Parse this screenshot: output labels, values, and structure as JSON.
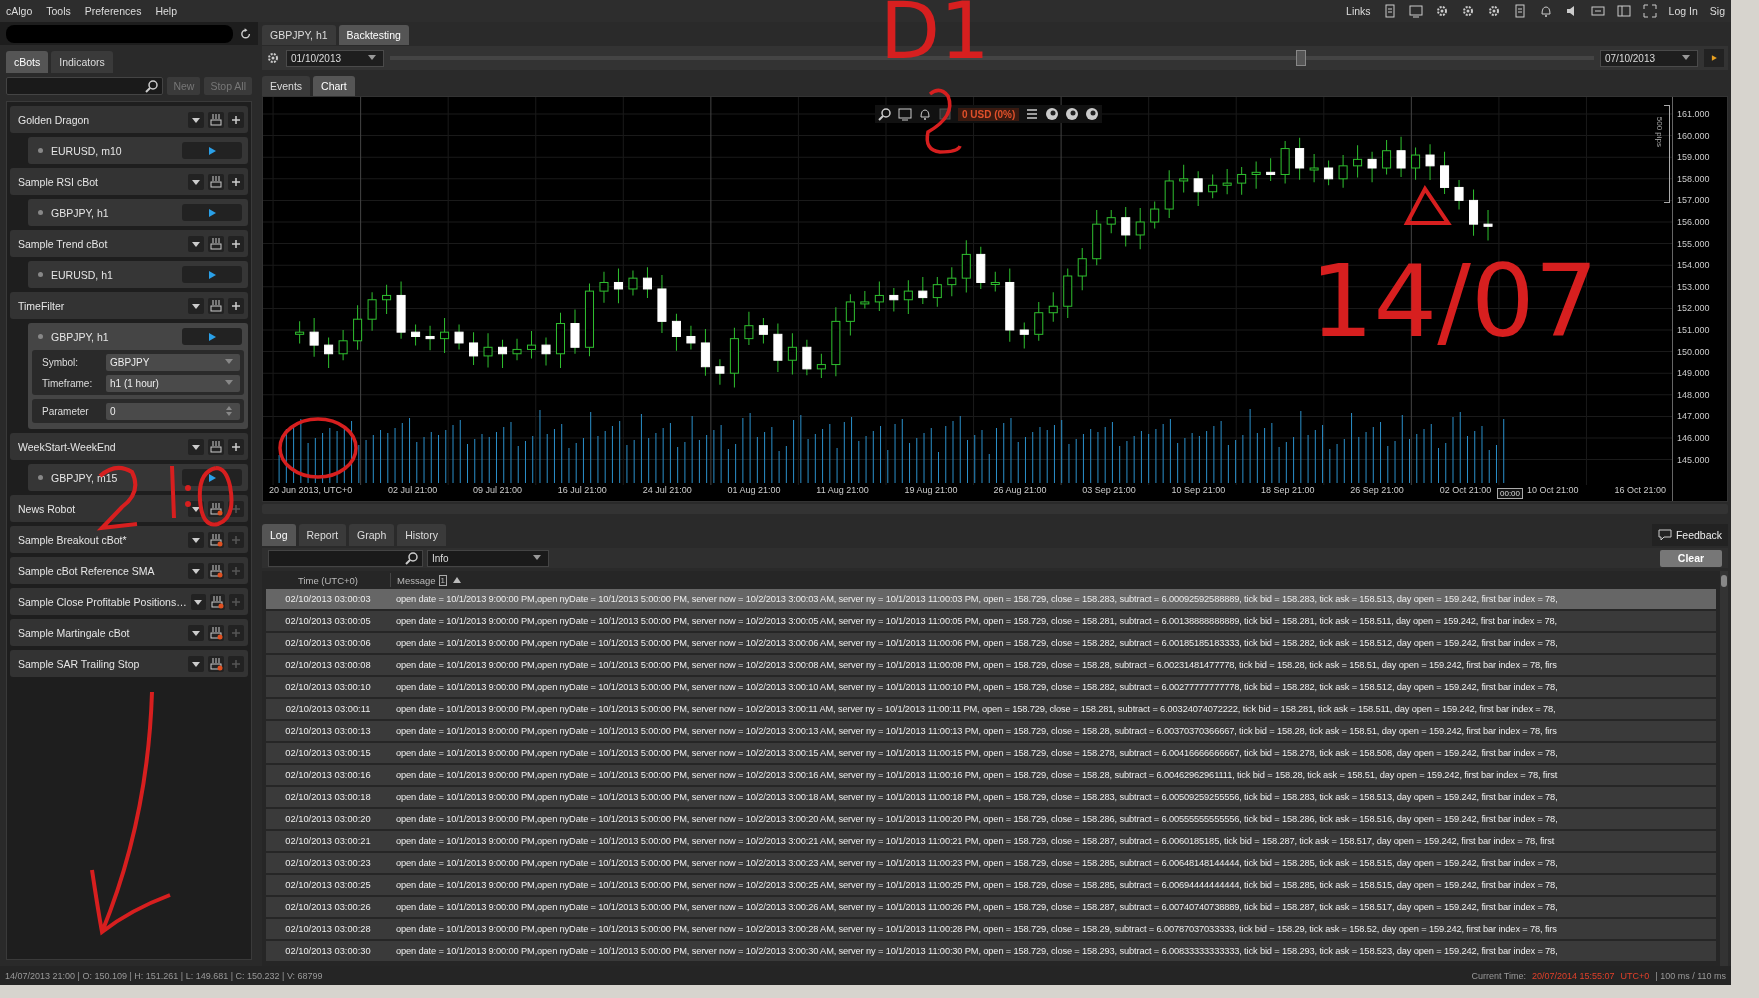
{
  "menu": [
    "cAlgo",
    "Tools",
    "Preferences",
    "Help"
  ],
  "header_right": {
    "links": "Links",
    "login": "Log In",
    "signup": "Sig"
  },
  "sidebar": {
    "tabs": [
      {
        "label": "cBots",
        "selected": true
      },
      {
        "label": "Indicators",
        "selected": false
      }
    ],
    "buttons": [
      {
        "label": "New",
        "disabled": true
      },
      {
        "label": "Stop All",
        "disabled": true
      }
    ],
    "bots": [
      {
        "name": "Golden Dragon",
        "built": true,
        "instances": [
          {
            "symbol": "EURUSD, m10",
            "expanded": false
          }
        ]
      },
      {
        "name": "Sample RSI cBot",
        "built": true,
        "instances": [
          {
            "symbol": "GBPJPY, h1",
            "expanded": false
          }
        ]
      },
      {
        "name": "Sample Trend cBot",
        "built": true,
        "instances": [
          {
            "symbol": "EURUSD, h1",
            "expanded": false
          }
        ]
      },
      {
        "name": "TimeFilter",
        "built": true,
        "instances": [
          {
            "symbol": "GBPJPY, h1",
            "expanded": true,
            "parameters": [
              {
                "label": "Symbol:",
                "value": "GBPJPY",
                "kind": "select"
              },
              {
                "label": "Timeframe:",
                "value": "h1 (1 hour)",
                "kind": "select"
              },
              {
                "label": "Parameter",
                "value": "0",
                "kind": "number"
              }
            ]
          }
        ]
      },
      {
        "name": "WeekStart-WeekEnd",
        "built": true,
        "instances": [
          {
            "symbol": "GBPJPY, m15",
            "expanded": false
          }
        ]
      },
      {
        "name": "News Robot",
        "built": false
      },
      {
        "name": "Sample Breakout cBot*",
        "built": false
      },
      {
        "name": "Sample cBot Reference SMA",
        "built": false
      },
      {
        "name": "Sample Close Profitable Positions…",
        "built": false
      },
      {
        "name": "Sample Martingale cBot",
        "built": false
      },
      {
        "name": "Sample SAR Trailing Stop",
        "built": false
      }
    ]
  },
  "tabs": [
    {
      "label": "GBPJPY, h1",
      "selected": false
    },
    {
      "label": "Backtesting",
      "selected": true
    }
  ],
  "backtest": {
    "start": "01/10/2013",
    "end": "07/10/2013",
    "level": 0.757
  },
  "view_tabs": [
    {
      "label": "Events",
      "selected": false
    },
    {
      "label": "Chart",
      "selected": true
    }
  ],
  "chart": {
    "balance": "0 USD (0%)",
    "pips_label": "500 pips",
    "cursor_label": "00:00",
    "y_labels": [
      "161.000",
      "160.000",
      "159.000",
      "158.000",
      "157.000",
      "156.000",
      "155.000",
      "154.000",
      "153.000",
      "152.000",
      "151.000",
      "150.000",
      "149.000",
      "148.000",
      "147.000",
      "146.000",
      "145.000"
    ],
    "x_labels": [
      "20 Jun 2013, UTC+0",
      "02 Jul 21:00",
      "09 Jul 21:00",
      "16 Jul 21:00",
      "24 Jul 21:00",
      "01 Aug 21:00",
      "11 Aug 21:00",
      "19 Aug 21:00",
      "26 Aug 21:00",
      "03 Sep 21:00",
      "10 Sep 21:00",
      "18 Sep 21:00",
      "26 Sep 21:00",
      "02 Oct 21:00",
      "10 Oct 21:00",
      "16 Oct 21:00"
    ]
  },
  "log": {
    "tabs": [
      {
        "label": "Log",
        "selected": true
      },
      {
        "label": "Report",
        "selected": false
      },
      {
        "label": "Graph",
        "selected": false
      },
      {
        "label": "History",
        "selected": false
      }
    ],
    "feedback": "Feedback",
    "level": "Info",
    "clear": "Clear",
    "columns": {
      "time": "Time (UTC+0)",
      "message": "Message",
      "filter_count": "1"
    },
    "rows": [
      {
        "time": "02/10/2013 03:00:03",
        "selected": true,
        "message": "open date = 10/1/2013 9:00:00 PM,open nyDate = 10/1/2013 5:00:00 PM, server now = 10/2/2013 3:00:03 AM, server ny = 10/1/2013 11:00:03 PM, open = 158.729, close = 158.283, subtract = 6.00092592588889, tick bid = 158.283, tick ask = 158.513, day open = 159.242, first bar index = 78,"
      },
      {
        "time": "02/10/2013 03:00:05",
        "selected": false,
        "message": "open date = 10/1/2013 9:00:00 PM,open nyDate = 10/1/2013 5:00:00 PM, server now = 10/2/2013 3:00:05 AM, server ny = 10/1/2013 11:00:05 PM, open = 158.729, close = 158.281, subtract = 6.00138888888889, tick bid = 158.281, tick ask = 158.511, day open = 159.242, first bar index = 78,"
      },
      {
        "time": "02/10/2013 03:00:06",
        "selected": false,
        "message": "open date = 10/1/2013 9:00:00 PM,open nyDate = 10/1/2013 5:00:00 PM, server now = 10/2/2013 3:00:06 AM, server ny = 10/1/2013 11:00:06 PM, open = 158.729, close = 158.282, subtract = 6.00185185183333, tick bid = 158.282, tick ask = 158.512, day open = 159.242, first bar index = 78,"
      },
      {
        "time": "02/10/2013 03:00:08",
        "selected": false,
        "message": "open date = 10/1/2013 9:00:00 PM,open nyDate = 10/1/2013 5:00:00 PM, server now = 10/2/2013 3:00:08 AM, server ny = 10/1/2013 11:00:08 PM, open = 158.729, close = 158.28, subtract = 6.00231481477778, tick bid = 158.28, tick ask = 158.51, day open = 159.242, first bar index = 78, firs"
      },
      {
        "time": "02/10/2013 03:00:10",
        "selected": false,
        "message": "open date = 10/1/2013 9:00:00 PM,open nyDate = 10/1/2013 5:00:00 PM, server now = 10/2/2013 3:00:10 AM, server ny = 10/1/2013 11:00:10 PM, open = 158.729, close = 158.282, subtract = 6.00277777777778, tick bid = 158.282, tick ask = 158.512, day open = 159.242, first bar index = 78,"
      },
      {
        "time": "02/10/2013 03:00:11",
        "selected": false,
        "message": "open date = 10/1/2013 9:00:00 PM,open nyDate = 10/1/2013 5:00:00 PM, server now = 10/2/2013 3:00:11 AM, server ny = 10/1/2013 11:00:11 PM, open = 158.729, close = 158.281, subtract = 6.00324074072222, tick bid = 158.281, tick ask = 158.511, day open = 159.242, first bar index = 78,"
      },
      {
        "time": "02/10/2013 03:00:13",
        "selected": false,
        "message": "open date = 10/1/2013 9:00:00 PM,open nyDate = 10/1/2013 5:00:00 PM, server now = 10/2/2013 3:00:13 AM, server ny = 10/1/2013 11:00:13 PM, open = 158.729, close = 158.28, subtract = 6.00370370366667, tick bid = 158.28, tick ask = 158.51, day open = 159.242, first bar index = 78, firs"
      },
      {
        "time": "02/10/2013 03:00:15",
        "selected": false,
        "message": "open date = 10/1/2013 9:00:00 PM,open nyDate = 10/1/2013 5:00:00 PM, server now = 10/2/2013 3:00:15 AM, server ny = 10/1/2013 11:00:15 PM, open = 158.729, close = 158.278, subtract = 6.00416666666667, tick bid = 158.278, tick ask = 158.508, day open = 159.242, first bar index = 78,"
      },
      {
        "time": "02/10/2013 03:00:16",
        "selected": false,
        "message": "open date = 10/1/2013 9:00:00 PM,open nyDate = 10/1/2013 5:00:00 PM, server now = 10/2/2013 3:00:16 AM, server ny = 10/1/2013 11:00:16 PM, open = 158.729, close = 158.28, subtract = 6.00462962961111, tick bid = 158.28, tick ask = 158.51, day open = 159.242, first bar index = 78, first"
      },
      {
        "time": "02/10/2013 03:00:18",
        "selected": false,
        "message": "open date = 10/1/2013 9:00:00 PM,open nyDate = 10/1/2013 5:00:00 PM, server now = 10/2/2013 3:00:18 AM, server ny = 10/1/2013 11:00:18 PM, open = 158.729, close = 158.283, subtract = 6.00509259255556, tick bid = 158.283, tick ask = 158.513, day open = 159.242, first bar index = 78,"
      },
      {
        "time": "02/10/2013 03:00:20",
        "selected": false,
        "message": "open date = 10/1/2013 9:00:00 PM,open nyDate = 10/1/2013 5:00:00 PM, server now = 10/2/2013 3:00:20 AM, server ny = 10/1/2013 11:00:20 PM, open = 158.729, close = 158.286, subtract = 6.00555555555556, tick bid = 158.286, tick ask = 158.516, day open = 159.242, first bar index = 78,"
      },
      {
        "time": "02/10/2013 03:00:21",
        "selected": false,
        "message": "open date = 10/1/2013 9:00:00 PM,open nyDate = 10/1/2013 5:00:00 PM, server now = 10/2/2013 3:00:21 AM, server ny = 10/1/2013 11:00:21 PM, open = 158.729, close = 158.287, subtract = 6.0060185185, tick bid = 158.287, tick ask = 158.517, day open = 159.242, first bar index = 78, first"
      },
      {
        "time": "02/10/2013 03:00:23",
        "selected": false,
        "message": "open date = 10/1/2013 9:00:00 PM,open nyDate = 10/1/2013 5:00:00 PM, server now = 10/2/2013 3:00:23 AM, server ny = 10/1/2013 11:00:23 PM, open = 158.729, close = 158.285, subtract = 6.00648148144444, tick bid = 158.285, tick ask = 158.515, day open = 159.242, first bar index = 78,"
      },
      {
        "time": "02/10/2013 03:00:25",
        "selected": false,
        "message": "open date = 10/1/2013 9:00:00 PM,open nyDate = 10/1/2013 5:00:00 PM, server now = 10/2/2013 3:00:25 AM, server ny = 10/1/2013 11:00:25 PM, open = 158.729, close = 158.285, subtract = 6.00694444444444, tick bid = 158.285, tick ask = 158.515, day open = 159.242, first bar index = 78,"
      },
      {
        "time": "02/10/2013 03:00:26",
        "selected": false,
        "message": "open date = 10/1/2013 9:00:00 PM,open nyDate = 10/1/2013 5:00:00 PM, server now = 10/2/2013 3:00:26 AM, server ny = 10/1/2013 11:00:26 PM, open = 158.729, close = 158.287, subtract = 6.00740740738889, tick bid = 158.287, tick ask = 158.517, day open = 159.242, first bar index = 78,"
      },
      {
        "time": "02/10/2013 03:00:28",
        "selected": false,
        "message": "open date = 10/1/2013 9:00:00 PM,open nyDate = 10/1/2013 5:00:00 PM, server now = 10/2/2013 3:00:28 AM, server ny = 10/1/2013 11:00:28 PM, open = 158.729, close = 158.29, subtract = 6.00787037033333, tick bid = 158.29, tick ask = 158.52, day open = 159.242, first bar index = 78, firs"
      },
      {
        "time": "02/10/2013 03:00:30",
        "selected": false,
        "message": "open date = 10/1/2013 9:00:00 PM,open nyDate = 10/1/2013 5:00:00 PM, server now = 10/2/2013 3:00:30 AM, server ny = 10/1/2013 11:00:30 PM, open = 158.729, close = 158.293, subtract = 6.00833333333333, tick bid = 158.293, tick ask = 158.523, day open = 159.242, first bar index = 78,"
      }
    ]
  },
  "status": {
    "bar": "14/07/2013 21:00 | O: 150.109 | H: 151.261 | L: 149.681 | C: 150.232 | V: 68799",
    "current_label": "Current Time:",
    "current_time": "20/07/2014 15:55:07",
    "timezone": "UTC+0",
    "latency": "| 100 ms / 110 ms"
  },
  "annotations": [
    {
      "kind": "text",
      "text": "D1"
    },
    {
      "kind": "hook"
    },
    {
      "kind": "triangle"
    },
    {
      "kind": "text",
      "text": "14/07"
    },
    {
      "kind": "circle"
    },
    {
      "kind": "scribble"
    },
    {
      "kind": "arrow"
    }
  ]
}
